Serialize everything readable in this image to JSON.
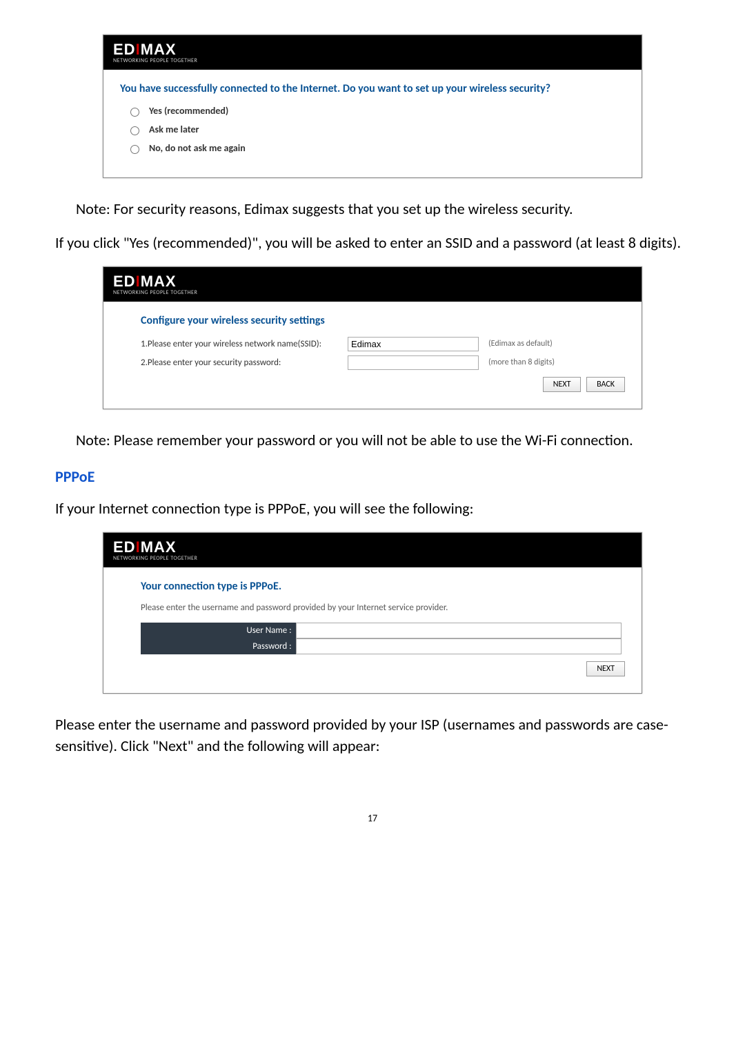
{
  "logo_sub": "NETWORKING PEOPLE TOGETHER",
  "panel1": {
    "title": "You have successfully connected to the Internet. Do you want to set up your wireless security?",
    "opt1": "Yes (recommended)",
    "opt2": "Ask me later",
    "opt3": "No, do not ask me again"
  },
  "text1": "Note: For security reasons, Edimax suggests that you set up the wireless security.",
  "text2": "If you click \"Yes (recommended)\", you will be asked to enter an SSID and a password (at least 8 digits).",
  "panel2": {
    "title": "Configure your wireless security settings",
    "row1_label": "1.Please enter your wireless network name(SSID):",
    "row1_value": "Edimax",
    "row1_hint": "(Edimax as default)",
    "row2_label": "2.Please enter your security password:",
    "row2_hint": "(more than 8 digits)",
    "btn_next": "NEXT",
    "btn_back": "BACK"
  },
  "text3": "Note: Please remember your password or you will not be able to use the Wi-Fi connection.",
  "h_pppoe": "PPPoE",
  "text4": "If your Internet connection type is PPPoE, you will see the following:",
  "panel3": {
    "title": "Your connection type is PPPoE.",
    "subtitle": "Please enter the username and password provided by your Internet service provider.",
    "user_label": "User Name :",
    "pass_label": "Password :",
    "btn_next": "NEXT"
  },
  "text5": "Please enter the username and password provided by your ISP (usernames and passwords are case-sensitive). Click \"Next\" and the following will appear:",
  "page_num": "17"
}
